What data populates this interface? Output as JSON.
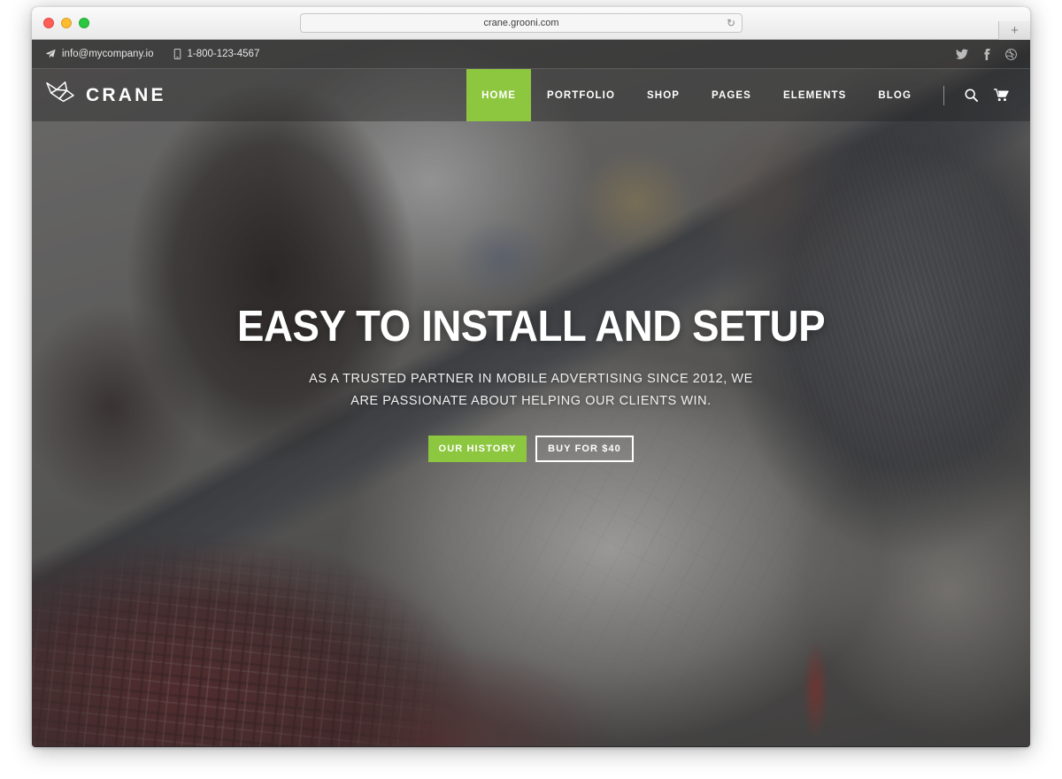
{
  "browser": {
    "url": "crane.grooni.com",
    "reload_icon": "reload-icon",
    "new_tab_label": "+",
    "traffic_lights": [
      "close",
      "minimize",
      "zoom"
    ]
  },
  "topbar": {
    "email": "info@mycompany.io",
    "email_icon": "paper-plane-icon",
    "phone": "1-800-123-4567",
    "phone_icon": "mobile-phone-icon",
    "social": [
      {
        "name": "twitter-icon",
        "label": "Twitter"
      },
      {
        "name": "facebook-icon",
        "label": "Facebook"
      },
      {
        "name": "dribbble-icon",
        "label": "Dribbble"
      }
    ]
  },
  "navbar": {
    "logo_text": "CRANE",
    "logo_icon": "origami-crane-icon",
    "menu": [
      {
        "label": "HOME",
        "active": true
      },
      {
        "label": "PORTFOLIO",
        "active": false
      },
      {
        "label": "SHOP",
        "active": false
      },
      {
        "label": "PAGES",
        "active": false
      },
      {
        "label": "ELEMENTS",
        "active": false
      },
      {
        "label": "BLOG",
        "active": false
      }
    ],
    "search_icon": "search-icon",
    "cart_icon": "shopping-cart-icon"
  },
  "hero": {
    "title": "EASY TO INSTALL AND SETUP",
    "subtitle": "AS A TRUSTED PARTNER IN MOBILE ADVERTISING SINCE 2012, WE ARE PASSIONATE ABOUT HELPING OUR CLIENTS WIN.",
    "primary_button": "OUR HISTORY",
    "secondary_button": "BUY FOR $40"
  },
  "colors": {
    "accent_green": "#8dc63f",
    "topbar_overlay": "#222222",
    "text_light": "#ffffff"
  }
}
